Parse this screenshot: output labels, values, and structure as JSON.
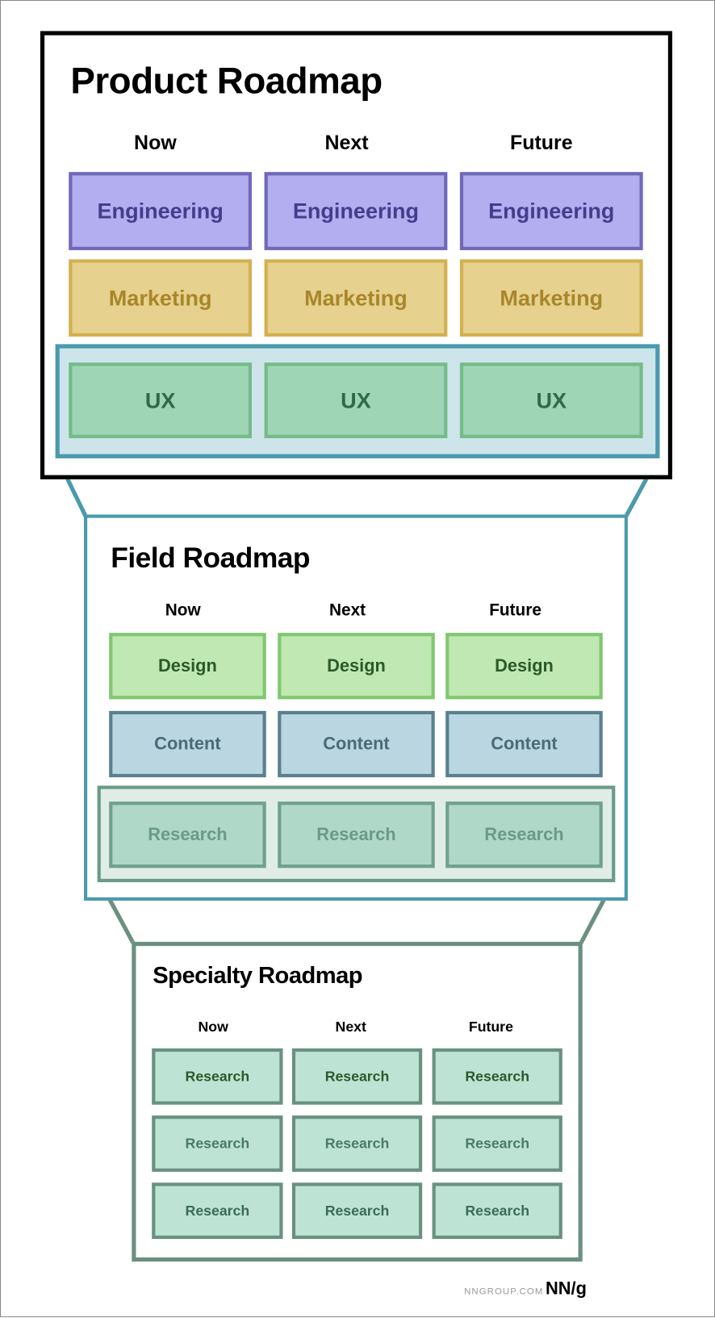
{
  "product": {
    "title": "Product Roadmap",
    "columns": [
      "Now",
      "Next",
      "Future"
    ],
    "rows": [
      {
        "label": "Engineering",
        "fill": "#b3aef0",
        "border": "#7068b8",
        "text": "#433d8c"
      },
      {
        "label": "Marketing",
        "fill": "#e6d18e",
        "border": "#d4b050",
        "text": "#a8862a"
      },
      {
        "label": "UX",
        "fill": "#9dd5b5",
        "border": "#75bb88",
        "text": "#2e6a4a"
      }
    ],
    "border_color": "#000000",
    "highlight_color": "#4a9aac"
  },
  "field": {
    "title": "Field Roadmap",
    "columns": [
      "Now",
      "Next",
      "Future"
    ],
    "rows": [
      {
        "label": "Design",
        "fill": "#c0e8b2",
        "border": "#80c870",
        "text": "#2a5a2a"
      },
      {
        "label": "Content",
        "fill": "#bad6e0",
        "border": "#5a8090",
        "text": "#4a6a78"
      },
      {
        "label": "Research",
        "fill": "#b0d8c8",
        "border": "#70a090",
        "text": "#6a9a88"
      }
    ],
    "border_color": "#4a9aac",
    "highlight_color": "#6a9a88"
  },
  "specialty": {
    "title": "Specialty Roadmap",
    "columns": [
      "Now",
      "Next",
      "Future"
    ],
    "rows": [
      {
        "label": "Research",
        "fill": "#bde3d5",
        "border": "#6a9080",
        "text": "#2a5a2a"
      },
      {
        "label": "Research",
        "fill": "#bde3d5",
        "border": "#6a9080",
        "text": "#4a7a6a"
      },
      {
        "label": "Research",
        "fill": "#bde3d5",
        "border": "#6a9080",
        "text": "#3a6a5a"
      }
    ],
    "border_color": "#6a9080"
  },
  "footer": {
    "url": "NNGROUP.COM",
    "logo": "NN/g"
  }
}
